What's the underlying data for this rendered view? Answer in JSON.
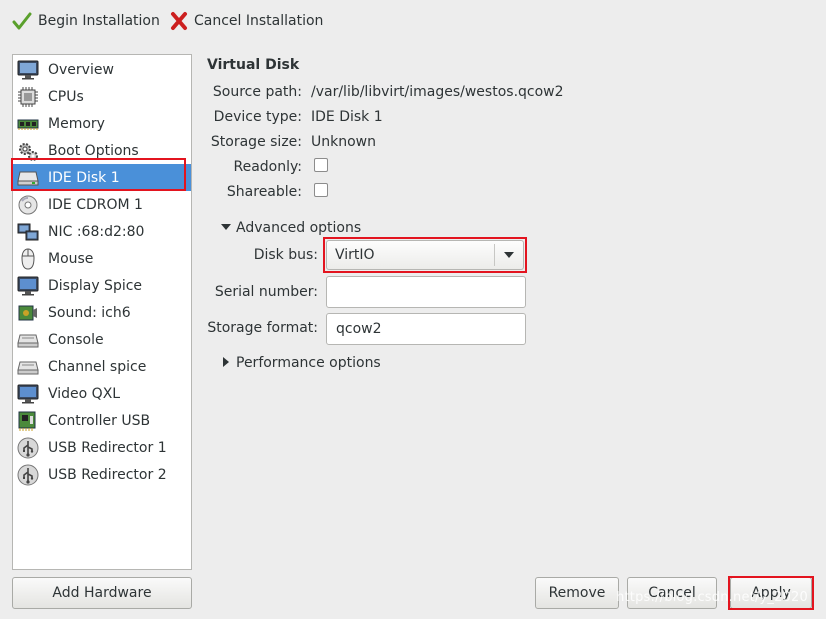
{
  "toolbar": {
    "begin_label": "Begin Installation",
    "cancel_label": "Cancel Installation"
  },
  "sidebar": {
    "items": [
      {
        "label": "Overview",
        "icon": "monitor-icon"
      },
      {
        "label": "CPUs",
        "icon": "cpu-chip-icon"
      },
      {
        "label": "Memory",
        "icon": "memory-module-icon"
      },
      {
        "label": "Boot Options",
        "icon": "gears-icon"
      },
      {
        "label": "IDE Disk 1",
        "icon": "hard-disk-icon",
        "selected": true
      },
      {
        "label": "IDE CDROM 1",
        "icon": "cdrom-icon"
      },
      {
        "label": "NIC :68:d2:80",
        "icon": "network-icon"
      },
      {
        "label": "Mouse",
        "icon": "mouse-icon"
      },
      {
        "label": "Display Spice",
        "icon": "display-icon"
      },
      {
        "label": "Sound: ich6",
        "icon": "sound-card-icon"
      },
      {
        "label": "Console",
        "icon": "serial-console-icon"
      },
      {
        "label": "Channel spice",
        "icon": "channel-icon"
      },
      {
        "label": "Video QXL",
        "icon": "video-card-icon"
      },
      {
        "label": "Controller USB",
        "icon": "controller-card-icon"
      },
      {
        "label": "USB Redirector 1",
        "icon": "usb-icon"
      },
      {
        "label": "USB Redirector 2",
        "icon": "usb-icon"
      }
    ]
  },
  "details": {
    "title": "Virtual Disk",
    "source_path_label": "Source path:",
    "source_path": "/var/lib/libvirt/images/westos.qcow2",
    "device_type_label": "Device type:",
    "device_type": "IDE Disk 1",
    "storage_size_label": "Storage size:",
    "storage_size": "Unknown",
    "readonly_label": "Readonly:",
    "readonly_checked": false,
    "shareable_label": "Shareable:",
    "shareable_checked": false,
    "advanced_label": "Advanced options",
    "disk_bus_label": "Disk bus:",
    "disk_bus_value": "VirtIO",
    "serial_label": "Serial number:",
    "serial_value": "",
    "storage_format_label": "Storage format:",
    "storage_format_value": "qcow2",
    "performance_label": "Performance options"
  },
  "buttons": {
    "add_hardware": "Add Hardware",
    "remove": "Remove",
    "cancel": "Cancel",
    "apply": "Apply"
  },
  "watermark": "https://blog.csdn.net/y_2020",
  "colors": {
    "selection": "#4a90d9",
    "highlight_box": "#e3141f",
    "window_bg": "#ededed"
  }
}
